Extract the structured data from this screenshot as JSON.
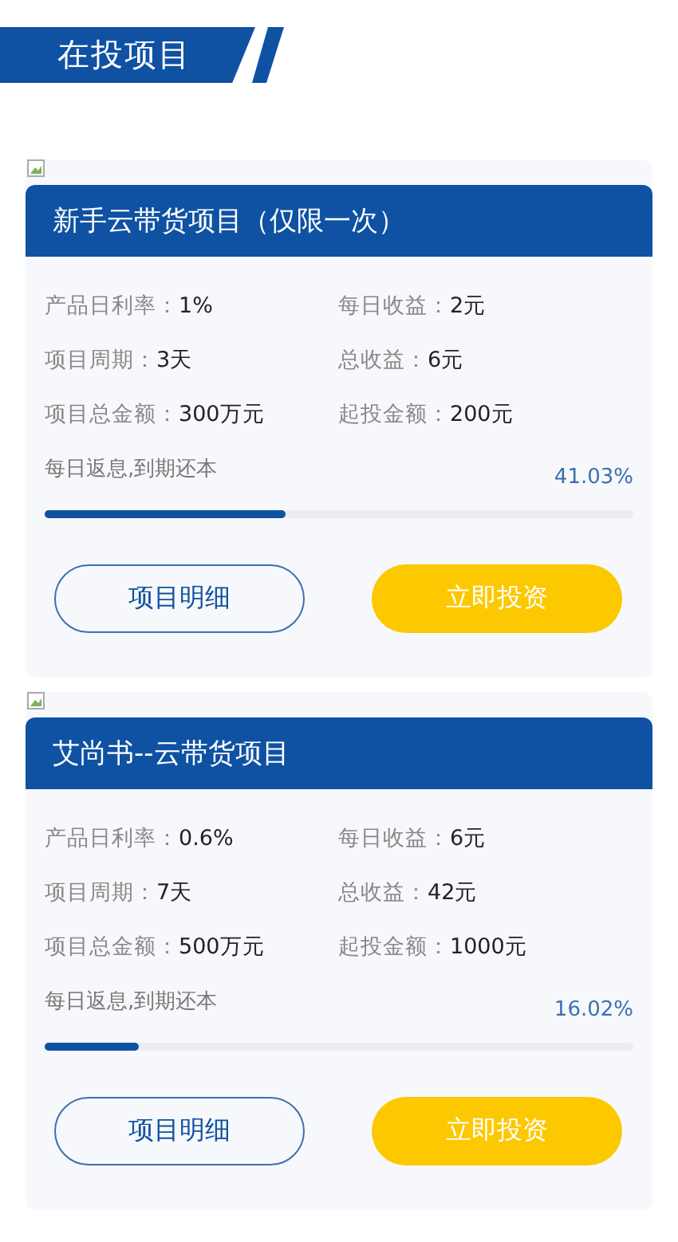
{
  "header": {
    "title": "在投项目"
  },
  "projects": [
    {
      "name": "新手云带货项目（仅限一次）",
      "fields": [
        {
          "label": "产品日利率：",
          "value": "1%"
        },
        {
          "label": "每日收益：",
          "value": "2元"
        },
        {
          "label": "项目周期：",
          "value": "3天"
        },
        {
          "label": "总收益：",
          "value": "6元"
        },
        {
          "label": "项目总金额：",
          "value": "300万元"
        },
        {
          "label": "起投金额：",
          "value": "200元"
        }
      ],
      "note": "每日返息,到期还本",
      "percent": "41.03%",
      "level": 0.4103,
      "buttons": [
        "项目明细",
        "立即投资"
      ]
    },
    {
      "name": "艾尚书--云带货项目",
      "fields": [
        {
          "label": "产品日利率：",
          "value": "0.6%"
        },
        {
          "label": "每日收益：",
          "value": "6元"
        },
        {
          "label": "项目周期：",
          "value": "7天"
        },
        {
          "label": "总收益：",
          "value": "42元"
        },
        {
          "label": "项目总金额：",
          "value": "500万元"
        },
        {
          "label": "起投金额：",
          "value": "1000元"
        }
      ],
      "note": "每日返息,到期还本",
      "percent": "16.02%",
      "level": 0.1602,
      "buttons": [
        "项目明细",
        "立即投资"
      ]
    }
  ]
}
